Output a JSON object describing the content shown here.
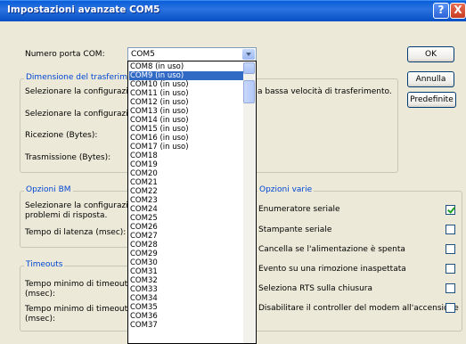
{
  "window": {
    "title": "Impostazioni avanzate COM5",
    "help": "?",
    "close": "X"
  },
  "port": {
    "label": "Numero porta COM:",
    "value": "COM5"
  },
  "buttons": {
    "ok": "OK",
    "cancel": "Annulla",
    "defaults": "Predefinite"
  },
  "transfer": {
    "title": "Dimensione del trasferimento",
    "desc1_visible": "Selezionare la configurazione",
    "desc1_tail": "a bassa velocità di trasferimento.",
    "desc2_visible": "Selezionare la configurazione",
    "rx_label": "Ricezione (Bytes):",
    "tx_label": "Trasmissione (Bytes):"
  },
  "bm": {
    "title": "Opzioni BM",
    "desc_line1": "Selezionare la configurazione",
    "desc_line2": "problemi di risposta.",
    "latency_label": "Tempo di latenza (msec):"
  },
  "timeouts": {
    "title": "Timeouts",
    "read_line1": "Tempo minimo di timeout in le",
    "read_line2": "(msec):",
    "write_line1": "Tempo minimo di timeout in s",
    "write_line2": "(msec):"
  },
  "misc": {
    "title": "Opzioni varie",
    "options": [
      {
        "label": "Enumeratore seriale",
        "checked": true
      },
      {
        "label": "Stampante seriale",
        "checked": false
      },
      {
        "label": "Cancella se l'alimentazione è spenta",
        "checked": false
      },
      {
        "label": "Evento su una rimozione inaspettata",
        "checked": false
      },
      {
        "label": "Seleziona RTS sulla chiusura",
        "checked": false
      },
      {
        "label": "Disabilitare il controller del modem all'accensione",
        "checked": false
      }
    ]
  },
  "dropdown": {
    "selected_index": 1,
    "items": [
      "COM8 (in uso)",
      "COM9 (in uso)",
      "COM10 (in uso)",
      "COM11 (in uso)",
      "COM12 (in uso)",
      "COM13 (in uso)",
      "COM14 (in uso)",
      "COM15 (in uso)",
      "COM16 (in uso)",
      "COM17 (in uso)",
      "COM18",
      "COM19",
      "COM20",
      "COM21",
      "COM22",
      "COM23",
      "COM24",
      "COM25",
      "COM26",
      "COM27",
      "COM28",
      "COM29",
      "COM30",
      "COM31",
      "COM32",
      "COM33",
      "COM34",
      "COM35",
      "COM36",
      "COM37"
    ]
  },
  "colors": {
    "titlebar": "#0a5fd8",
    "dialog_bg": "#ece9d8",
    "selection": "#316ac5",
    "group_title": "#0046d5"
  }
}
